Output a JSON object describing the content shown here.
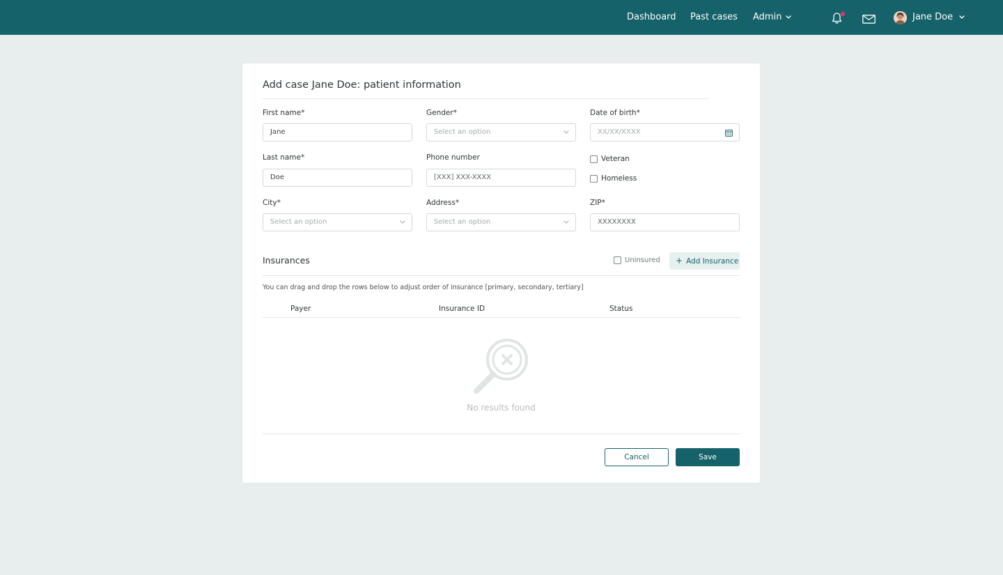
{
  "nav": {
    "links": [
      "Dashboard",
      "Past cases",
      "Admin"
    ],
    "user_name": "Jane Doe",
    "accent_color": "#15626a",
    "notification_dot_color": "#e8336b",
    "icons": [
      "bell-icon",
      "mail-icon",
      "chevron-down-icon"
    ]
  },
  "form": {
    "title": "Add case Jane Doe: patient information",
    "first_name": {
      "label": "First name*",
      "value": "Jane"
    },
    "gender": {
      "label": "Gender*",
      "placeholder": "Select an option"
    },
    "dob": {
      "label": "Date of birth*",
      "placeholder": "XX/XX/XXXX"
    },
    "last_name": {
      "label": "Last name*",
      "value": "Doe"
    },
    "phone": {
      "label": "Phone number",
      "placeholder": "[XXX] XXX-XXXX"
    },
    "veteran": {
      "label": "Veteran",
      "checked": false
    },
    "homeless": {
      "label": "Homeless",
      "checked": false
    },
    "city": {
      "label": "City*",
      "placeholder": "Select an option"
    },
    "address": {
      "label": "Address*",
      "placeholder": "Select an option"
    },
    "zip": {
      "label": "ZIP*",
      "placeholder": "XXXXXXXX"
    }
  },
  "insurances": {
    "title": "Insurances",
    "uninsured_label": "Uninsured",
    "uninsured_checked": false,
    "add_button": "Add Insurance",
    "hint": "You can drag and drop the rows below to adjust order of insurance [primary, secondary, tertiary]",
    "columns": [
      "Payer",
      "Insurance ID",
      "Status"
    ],
    "rows": [],
    "empty_text": "No results found"
  },
  "actions": {
    "cancel": "Cancel",
    "save": "Save"
  }
}
